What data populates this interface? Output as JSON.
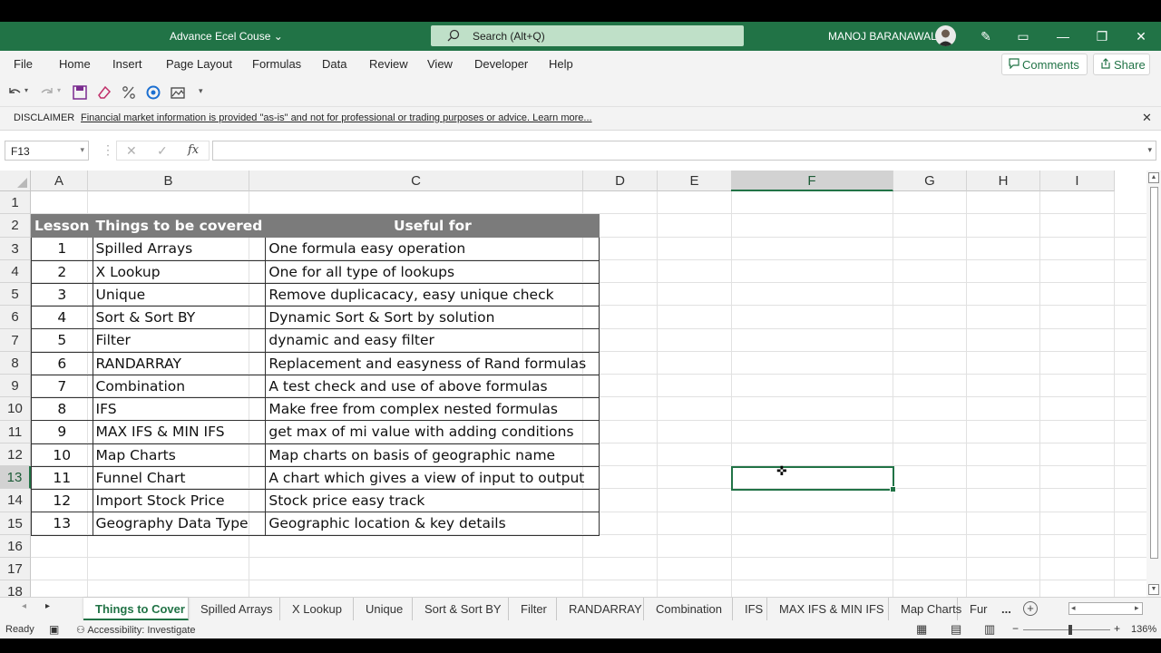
{
  "window": {
    "title": "Advance Ecel Couse",
    "search_placeholder": "Search (Alt+Q)",
    "user": "MANOJ BARANAWAL"
  },
  "menu": [
    "File",
    "Home",
    "Insert",
    "Page Layout",
    "Formulas",
    "Data",
    "Review",
    "View",
    "Developer",
    "Help"
  ],
  "actions": {
    "comments": "Comments",
    "share": "Share"
  },
  "disclaimer": {
    "label": "DISCLAIMER",
    "message": "Financial market information is provided \"as-is\" and not for professional or trading purposes or advice. Learn more..."
  },
  "formula_bar": {
    "name_box": "F13",
    "fx": "fx",
    "formula": ""
  },
  "columns": [
    "A",
    "B",
    "C",
    "D",
    "E",
    "F",
    "G",
    "H",
    "I"
  ],
  "selected_column": "F",
  "rows": [
    "1",
    "2",
    "3",
    "4",
    "5",
    "6",
    "7",
    "8",
    "9",
    "10",
    "11",
    "12",
    "13",
    "14",
    "15",
    "16",
    "17",
    "18"
  ],
  "selected_row": "13",
  "table": {
    "headers": [
      "Lesson",
      "Things to be covered",
      "Useful for"
    ],
    "rows": [
      [
        "1",
        "Spilled Arrays",
        "One formula easy operation"
      ],
      [
        "2",
        "X Lookup",
        "One for all type of lookups"
      ],
      [
        "3",
        "Unique",
        "Remove duplicacacy, easy unique check"
      ],
      [
        "4",
        "Sort & Sort BY",
        "Dynamic Sort & Sort by solution"
      ],
      [
        "5",
        "Filter",
        "dynamic and easy filter"
      ],
      [
        "6",
        "RANDARRAY",
        "Replacement and easyness of Rand formulas"
      ],
      [
        "7",
        "Combination",
        "A test check and use of above formulas"
      ],
      [
        "8",
        "IFS",
        "Make free from complex nested formulas"
      ],
      [
        "9",
        "MAX IFS & MIN IFS",
        "get max of mi value with adding conditions"
      ],
      [
        "10",
        "Map Charts",
        "Map charts on basis of geographic name"
      ],
      [
        "11",
        "Funnel Chart",
        "A chart which gives a view of input to output"
      ],
      [
        "12",
        "Import Stock Price",
        "Stock price easy track"
      ],
      [
        "13",
        "Geography Data Type",
        "Geographic location & key details"
      ]
    ]
  },
  "sheet_tabs": [
    "Things to Cover",
    "Spilled Arrays",
    "X Lookup",
    "Unique",
    "Sort & Sort BY",
    "Filter",
    "RANDARRAY",
    "Combination",
    "IFS",
    "MAX IFS & MIN IFS",
    "Map Charts",
    "Fur"
  ],
  "active_tab": "Things to Cover",
  "more_tabs": "...",
  "status": {
    "ready": "Ready",
    "accessibility": "Accessibility: Investigate",
    "zoom": "136%"
  },
  "colors": {
    "brand": "#217346",
    "header_fill": "#7b7b7b"
  }
}
